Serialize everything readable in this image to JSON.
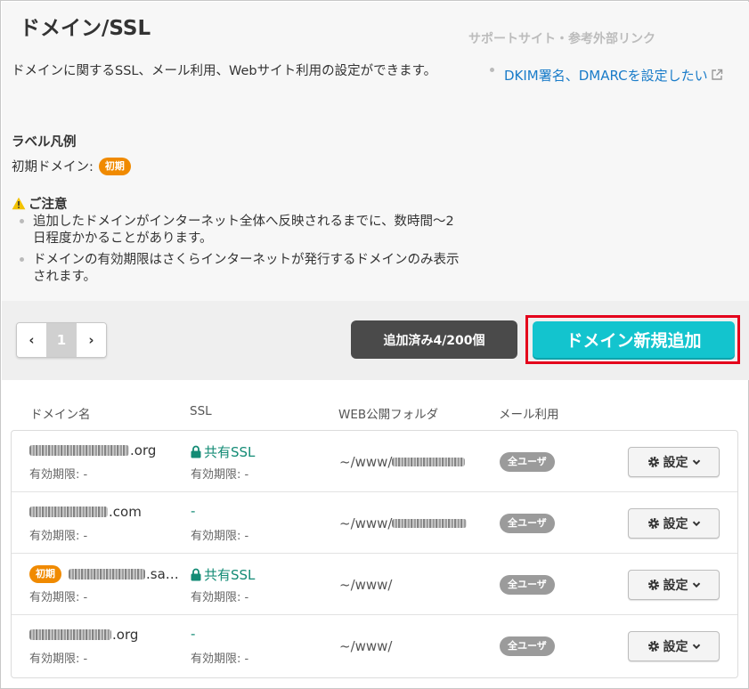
{
  "page": {
    "title": "ドメイン/SSL",
    "description": "ドメインに関するSSL、メール利用、Webサイト利用の設定ができます。"
  },
  "support": {
    "heading": "サポートサイト・参考外部リンク",
    "link_label": "DKIM署名、DMARCを設定したい"
  },
  "legend": {
    "heading": "ラベル凡例",
    "initial_domain_label": "初期ドメイン:",
    "initial_badge": "初期"
  },
  "notice": {
    "heading": "ご注意",
    "items": [
      "追加したドメインがインターネット全体へ反映されるまでに、数時間〜2日程度かかることがあります。",
      "ドメインの有効期限はさくらインターネットが発行するドメインのみ表示されます。"
    ]
  },
  "toolbar": {
    "pager": {
      "prev": "‹",
      "current": "1",
      "next": "›"
    },
    "count_label": "追加済み4/200個",
    "add_button_label": "ドメイン新規追加"
  },
  "table": {
    "headers": {
      "domain": "ドメイン名",
      "ssl": "SSL",
      "folder": "WEB公開フォルダ",
      "mail": "メール利用"
    },
    "expiry_label": "有効期限: -",
    "settings_label": "設定",
    "rows": [
      {
        "domain_suffix": ".org",
        "ssl": "共有SSL",
        "folder_prefix": "~/www/",
        "mail": "全ユーザ",
        "initial": ""
      },
      {
        "domain_suffix": ".com",
        "ssl": "-",
        "folder_prefix": "~/www/",
        "mail": "全ユーザ",
        "initial": ""
      },
      {
        "domain_suffix": ".sa…",
        "ssl": "共有SSL",
        "folder_prefix": "~/www/",
        "mail": "全ユーザ",
        "initial": "初期"
      },
      {
        "domain_suffix": ".org",
        "ssl": "-",
        "folder_prefix": "~/www/",
        "mail": "全ユーザ",
        "initial": ""
      }
    ]
  },
  "colors": {
    "accent_button": "#13c4ce",
    "highlight_border": "#e4001b",
    "initial_badge": "#f08a00",
    "ssl_text": "#138b75",
    "link": "#1a7cc9"
  }
}
